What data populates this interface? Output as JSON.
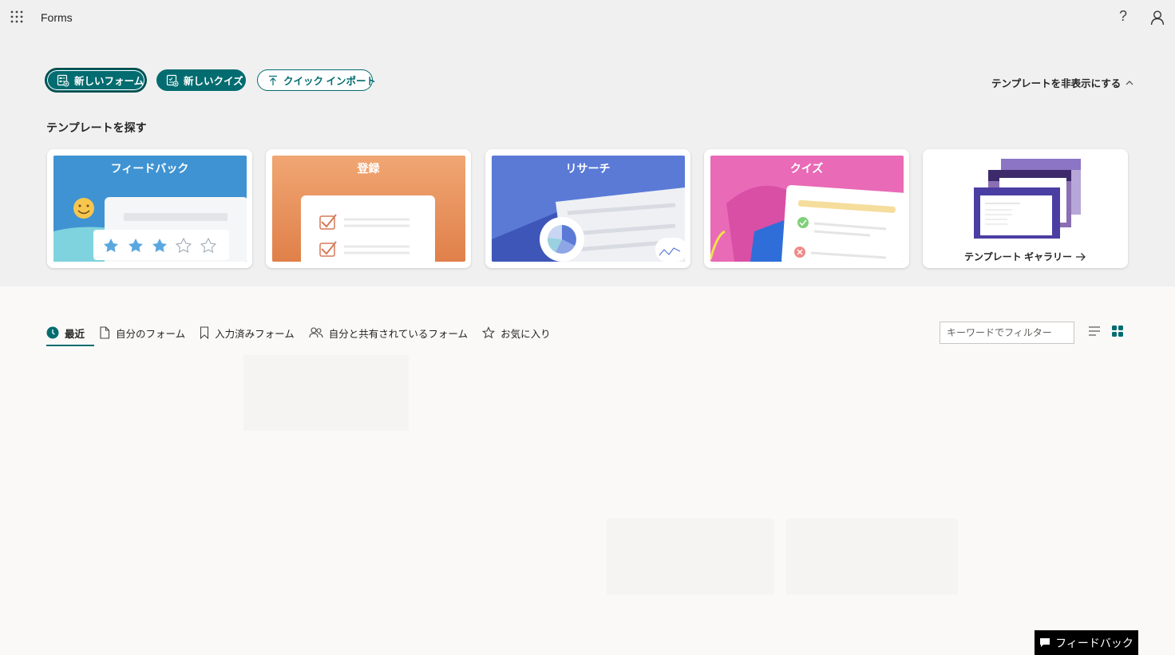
{
  "app": {
    "name": "Forms"
  },
  "header": {
    "help_glyph": "?"
  },
  "actions": {
    "new_form": "新しいフォーム",
    "new_quiz": "新しいクイズ",
    "quick_import": "クイック インポート",
    "hide_templates": "テンプレートを非表示にする"
  },
  "templates": {
    "title": "テンプレートを探す",
    "cards": [
      {
        "label": "フィードバック"
      },
      {
        "label": "登録"
      },
      {
        "label": "リサーチ"
      },
      {
        "label": "クイズ"
      }
    ],
    "gallery_label": "テンプレート ギャラリー",
    "colors": {
      "feedback": "#3d8fd0",
      "registration": "#e58652",
      "research": "#4f6fd0",
      "quiz": "#e46ab3"
    }
  },
  "tabs": [
    {
      "label": "最近",
      "icon": "clock-icon"
    },
    {
      "label": "自分のフォーム",
      "icon": "document-icon"
    },
    {
      "label": "入力済みフォーム",
      "icon": "bookmark-icon"
    },
    {
      "label": "自分と共有されているフォーム",
      "icon": "people-icon"
    },
    {
      "label": "お気に入り",
      "icon": "star-icon"
    }
  ],
  "filter": {
    "placeholder": "キーワードでフィルター"
  },
  "feedback_button": "フィードバック",
  "accent": "#036c70"
}
